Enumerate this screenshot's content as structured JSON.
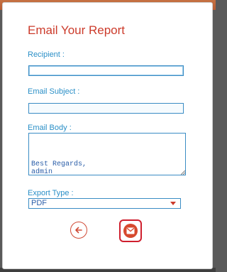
{
  "dialog": {
    "title": "Email Your Report"
  },
  "form": {
    "recipient": {
      "label": "Recipient :",
      "value": ""
    },
    "subject": {
      "label": "Email Subject :",
      "value": ""
    },
    "body": {
      "label": "Email Body :",
      "value": "\nBest Regards,\nadmin"
    },
    "export_type": {
      "label": "Export Type :",
      "selected": "PDF"
    }
  },
  "actions": {
    "back_icon": "arrow-left-circle-icon",
    "send_icon": "email-envelope-icon"
  },
  "colors": {
    "title": "#cc3b2b",
    "label": "#2a8fc7",
    "field_border": "#3a8cc4",
    "send_border": "#cf1f2e",
    "send_fill": "#d6492e"
  }
}
